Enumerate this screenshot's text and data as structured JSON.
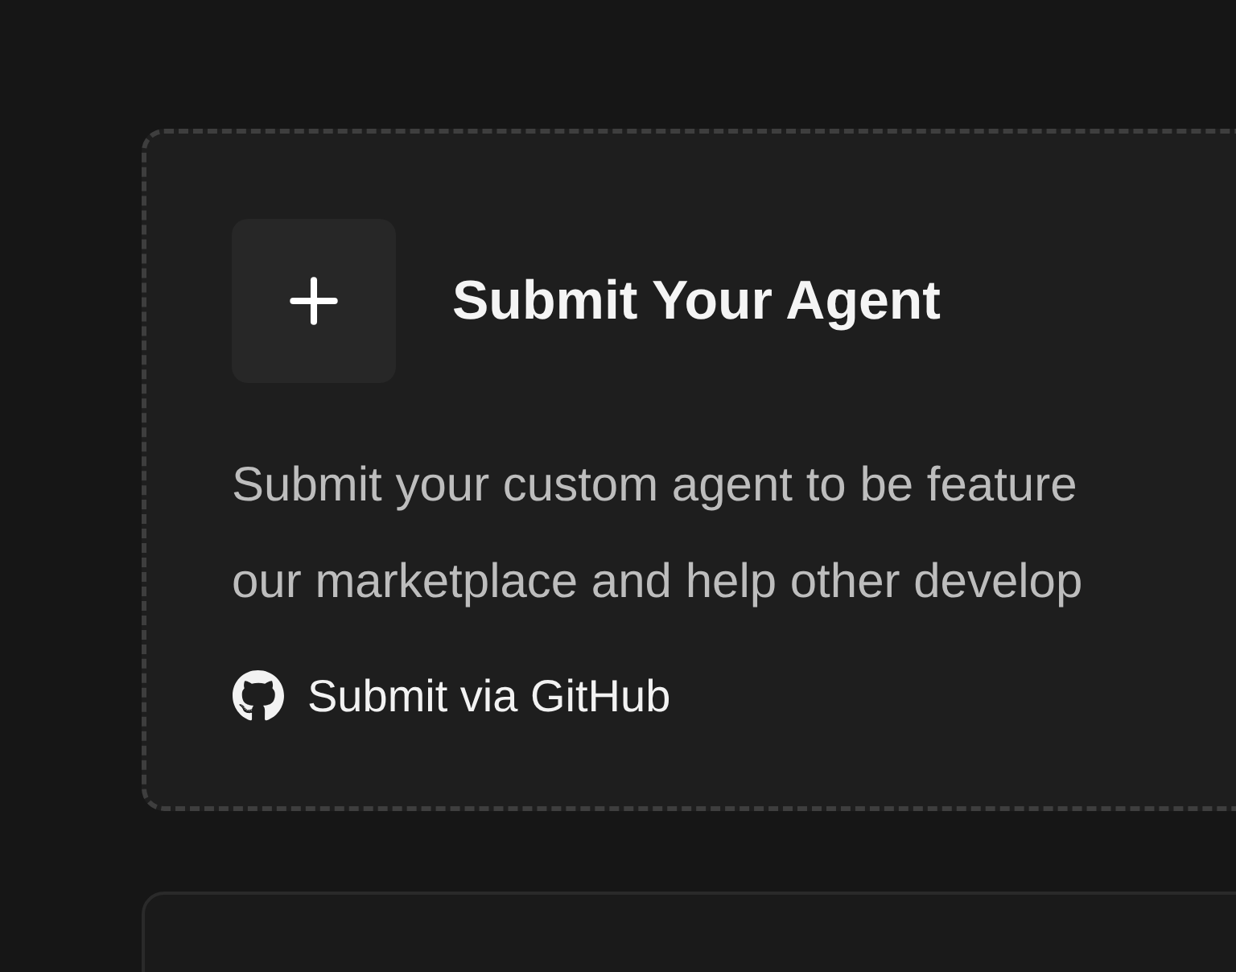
{
  "submit_card": {
    "title": "Submit Your Agent",
    "description_lines": [
      "Submit your custom agent to be feature",
      "our marketplace and help other develop"
    ],
    "link": "Submit via GitHub"
  }
}
